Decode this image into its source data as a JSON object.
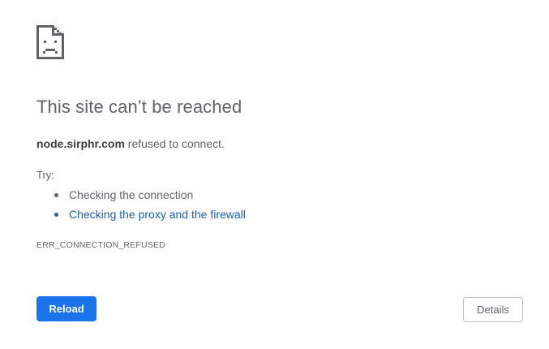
{
  "error": {
    "icon": "sad-page-icon",
    "title": "This site can’t be reached",
    "host": "node.sirphr.com",
    "summary_suffix": " refused to connect.",
    "try_label": "Try:",
    "suggestions": [
      {
        "text": "Checking the connection",
        "is_link": false
      },
      {
        "text": "Checking the proxy and the firewall",
        "is_link": true
      }
    ],
    "code": "ERR_CONNECTION_REFUSED"
  },
  "buttons": {
    "reload_label": "Reload",
    "details_label": "Details"
  },
  "colors": {
    "text": "#5f6368",
    "link": "#1a5fb4",
    "primary_button": "#1a73e8"
  }
}
